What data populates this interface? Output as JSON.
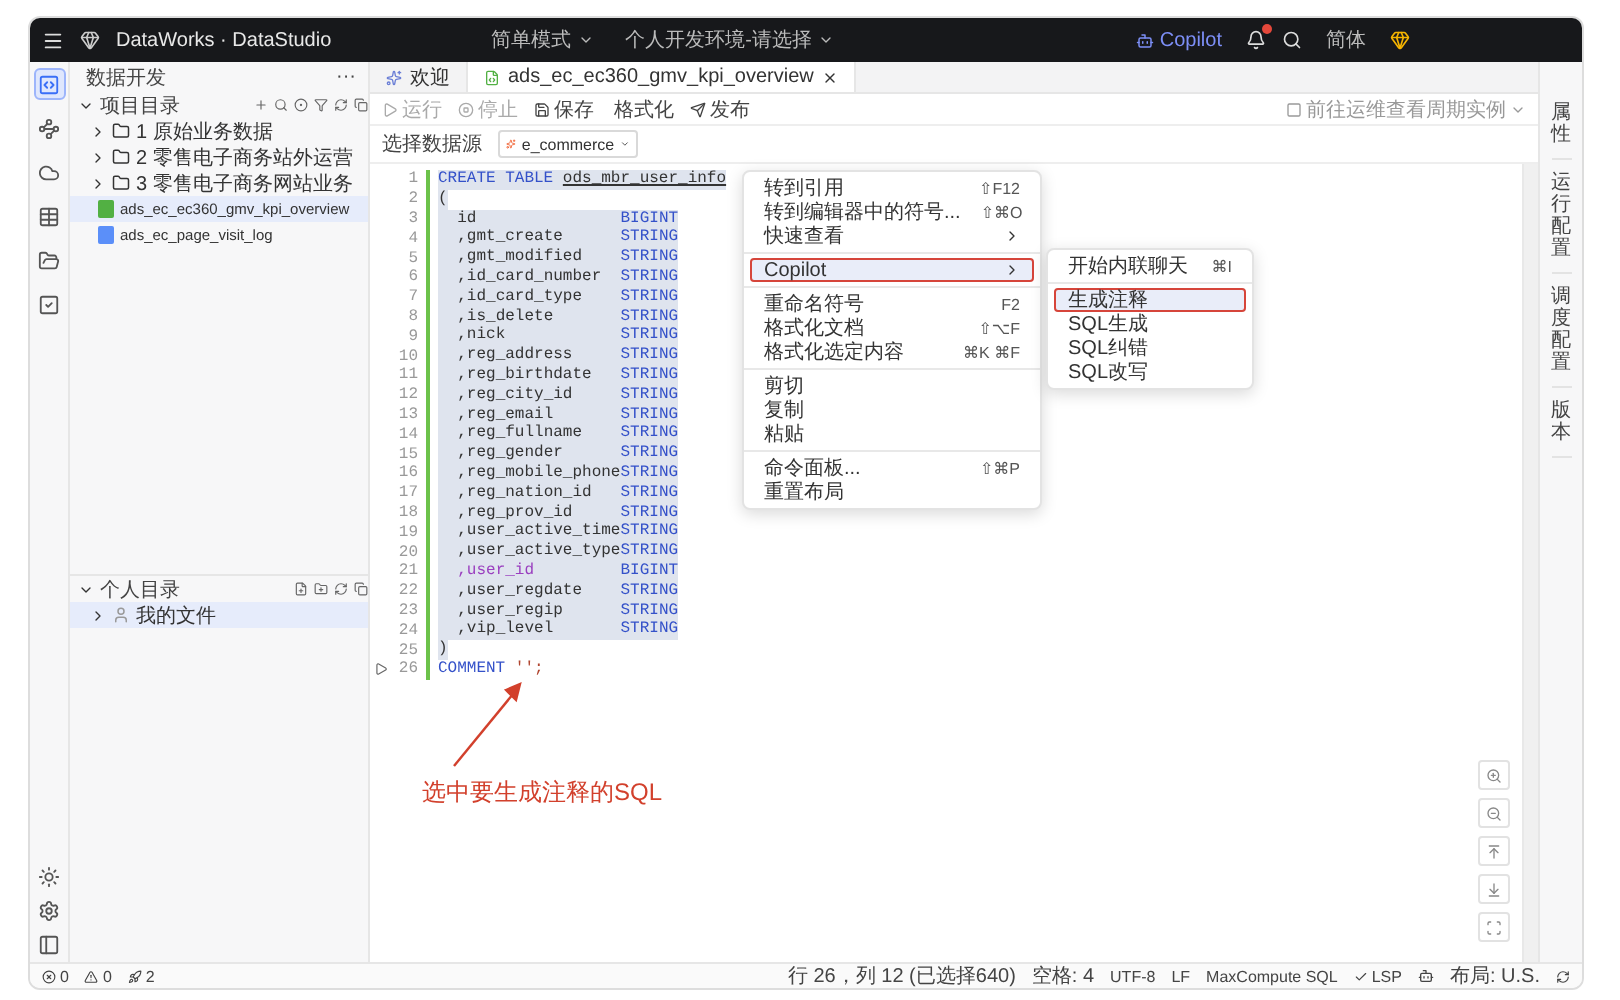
{
  "topbar": {
    "app_title": "DataWorks · DataStudio",
    "mode": "简单模式",
    "environment": "个人开发环境-请选择",
    "copilot": "Copilot",
    "language": "简体"
  },
  "activity_bar": [
    {
      "selected": true
    },
    {
      "selected": false
    },
    {
      "selected": false
    },
    {
      "selected": false
    },
    {
      "selected": false
    },
    {
      "selected": false
    }
  ],
  "sidebar": {
    "title": "数据开发",
    "more": "···",
    "project": {
      "label": "项目目录",
      "expanded": true,
      "children": [
        {
          "kind": "folder",
          "label": "1 原始业务数据",
          "expanded": false,
          "selected": false
        },
        {
          "kind": "folder",
          "label": "2 零售电子商务站外运营",
          "expanded": false,
          "selected": false
        },
        {
          "kind": "folder",
          "label": "3 零售电子商务网站业务",
          "expanded": false,
          "selected": false
        },
        {
          "kind": "file",
          "label": "ads_ec_ec360_gmv_kpi_overview",
          "color": "#52b043",
          "selected": true
        },
        {
          "kind": "file",
          "label": "ads_ec_page_visit_log",
          "color": "#5b8ff9",
          "selected": false
        }
      ]
    },
    "personal": {
      "label": "个人目录",
      "expanded": true,
      "children": [
        {
          "kind": "user_folder",
          "label": "我的文件",
          "expanded": false,
          "selected": true
        }
      ]
    }
  },
  "tabs": [
    {
      "label": "欢迎",
      "selected": false,
      "closable": false
    },
    {
      "label": "ads_ec_ec360_gmv_kpi_overview",
      "selected": true,
      "closable": true
    }
  ],
  "toolbar": [
    {
      "label": "运行",
      "disabled": true
    },
    {
      "label": "停止",
      "disabled": true
    },
    {
      "label": "保存",
      "disabled": false
    },
    {
      "label": "格式化",
      "disabled": false
    },
    {
      "label": "发布",
      "disabled": false
    }
  ],
  "cycle_instances": {
    "label": "前往运维查看周期实例",
    "checked": false
  },
  "datasource": {
    "label": "选择数据源",
    "value": "e_commerce"
  },
  "code_lines": [
    {
      "number": "1",
      "kind": "create",
      "keyword": "CREATE TABLE",
      "name": "ods_mbr_user_info",
      "selected": true
    },
    {
      "number": "2",
      "kind": "plain",
      "text": "(",
      "selected": true
    },
    {
      "number": "3",
      "kind": "column",
      "name": "id",
      "type": "BIGINT",
      "reference": false,
      "selected": true
    },
    {
      "number": "4",
      "kind": "column",
      "name": ",gmt_create",
      "type": "STRING",
      "reference": false,
      "selected": true
    },
    {
      "number": "5",
      "kind": "column",
      "name": ",gmt_modified",
      "type": "STRING",
      "reference": false,
      "selected": true
    },
    {
      "number": "6",
      "kind": "column",
      "name": ",id_card_number",
      "type": "STRING",
      "reference": false,
      "selected": true
    },
    {
      "number": "7",
      "kind": "column",
      "name": ",id_card_type",
      "type": "STRING",
      "reference": false,
      "selected": true
    },
    {
      "number": "8",
      "kind": "column",
      "name": ",is_delete",
      "type": "STRING",
      "reference": false,
      "selected": true
    },
    {
      "number": "9",
      "kind": "column",
      "name": ",nick",
      "type": "STRING",
      "reference": false,
      "selected": true
    },
    {
      "number": "10",
      "kind": "column",
      "name": ",reg_address",
      "type": "STRING",
      "reference": false,
      "selected": true
    },
    {
      "number": "11",
      "kind": "column",
      "name": ",reg_birthdate",
      "type": "STRING",
      "reference": false,
      "selected": true
    },
    {
      "number": "12",
      "kind": "column",
      "name": ",reg_city_id",
      "type": "STRING",
      "reference": false,
      "selected": true
    },
    {
      "number": "13",
      "kind": "column",
      "name": ",reg_email",
      "type": "STRING",
      "reference": false,
      "selected": true
    },
    {
      "number": "14",
      "kind": "column",
      "name": ",reg_fullname",
      "type": "STRING",
      "reference": false,
      "selected": true
    },
    {
      "number": "15",
      "kind": "column",
      "name": ",reg_gender",
      "type": "STRING",
      "reference": false,
      "selected": true
    },
    {
      "number": "16",
      "kind": "column",
      "name": ",reg_mobile_phone",
      "type": "STRING",
      "reference": false,
      "selected": true
    },
    {
      "number": "17",
      "kind": "column",
      "name": ",reg_nation_id",
      "type": "STRING",
      "reference": false,
      "selected": true
    },
    {
      "number": "18",
      "kind": "column",
      "name": ",reg_prov_id",
      "type": "STRING",
      "reference": false,
      "selected": true
    },
    {
      "number": "19",
      "kind": "column",
      "name": ",user_active_time",
      "type": "STRING",
      "reference": false,
      "selected": true
    },
    {
      "number": "20",
      "kind": "column",
      "name": ",user_active_type",
      "type": "STRING",
      "reference": false,
      "selected": true
    },
    {
      "number": "21",
      "kind": "column",
      "name": ",user_id",
      "type": "BIGINT",
      "reference": true,
      "selected": true
    },
    {
      "number": "22",
      "kind": "column",
      "name": ",user_regdate",
      "type": "STRING",
      "reference": false,
      "selected": true
    },
    {
      "number": "23",
      "kind": "column",
      "name": ",user_regip",
      "type": "STRING",
      "reference": false,
      "selected": true
    },
    {
      "number": "24",
      "kind": "column",
      "name": ",vip_level",
      "type": "STRING",
      "reference": false,
      "selected": true
    },
    {
      "number": "25",
      "kind": "plain",
      "text": ")",
      "selected": true
    },
    {
      "number": "26",
      "kind": "comment",
      "keyword": "COMMENT",
      "text": "'';",
      "selected": false
    }
  ],
  "context_menu": [
    {
      "kind": "item",
      "label": "转到引用",
      "shortcut": "⇧F12",
      "submenu": false,
      "selected": false
    },
    {
      "kind": "item",
      "label": "转到编辑器中的符号...",
      "shortcut": "⇧⌘O",
      "submenu": false,
      "selected": false
    },
    {
      "kind": "item",
      "label": "快速查看",
      "submenu": true,
      "selected": false
    },
    {
      "kind": "separator"
    },
    {
      "kind": "item",
      "label": "Copilot",
      "submenu": true,
      "selected": true
    },
    {
      "kind": "separator"
    },
    {
      "kind": "item",
      "label": "重命名符号",
      "shortcut": "F2",
      "submenu": false,
      "selected": false
    },
    {
      "kind": "item",
      "label": "格式化文档",
      "shortcut": "⇧⌥F",
      "submenu": false,
      "selected": false
    },
    {
      "kind": "item",
      "label": "格式化选定内容",
      "shortcut": "⌘K ⌘F",
      "submenu": false,
      "selected": false
    },
    {
      "kind": "separator"
    },
    {
      "kind": "item",
      "label": "剪切",
      "submenu": false,
      "selected": false
    },
    {
      "kind": "item",
      "label": "复制",
      "submenu": false,
      "selected": false
    },
    {
      "kind": "item",
      "label": "粘贴",
      "submenu": false,
      "selected": false
    },
    {
      "kind": "separator"
    },
    {
      "kind": "item",
      "label": "命令面板...",
      "shortcut": "⇧⌘P",
      "submenu": false,
      "selected": false
    },
    {
      "kind": "item",
      "label": "重置布局",
      "submenu": false,
      "selected": false
    }
  ],
  "copilot_submenu": [
    {
      "kind": "item",
      "label": "开始内联聊天",
      "shortcut": "⌘I",
      "selected": false
    },
    {
      "kind": "separator"
    },
    {
      "kind": "item",
      "label": "生成注释",
      "selected": true
    },
    {
      "kind": "item",
      "label": "SQL生成",
      "selected": false
    },
    {
      "kind": "item",
      "label": "SQL纠错",
      "selected": false
    },
    {
      "kind": "item",
      "label": "SQL改写",
      "selected": false
    }
  ],
  "annotation": {
    "text": "选中要生成注释的SQL"
  },
  "right_panel": [
    "属性",
    "运行配置",
    "调度配置",
    "版本"
  ],
  "status_bar": {
    "errors": "0",
    "warnings": "0",
    "tasks": "2",
    "position": "行 26，列 12 (已选择640)",
    "indent": "空格: 4",
    "encoding": "UTF-8",
    "eol": "LF",
    "language": "MaxCompute SQL",
    "lsp": "LSP",
    "layout": "布局: U.S."
  }
}
